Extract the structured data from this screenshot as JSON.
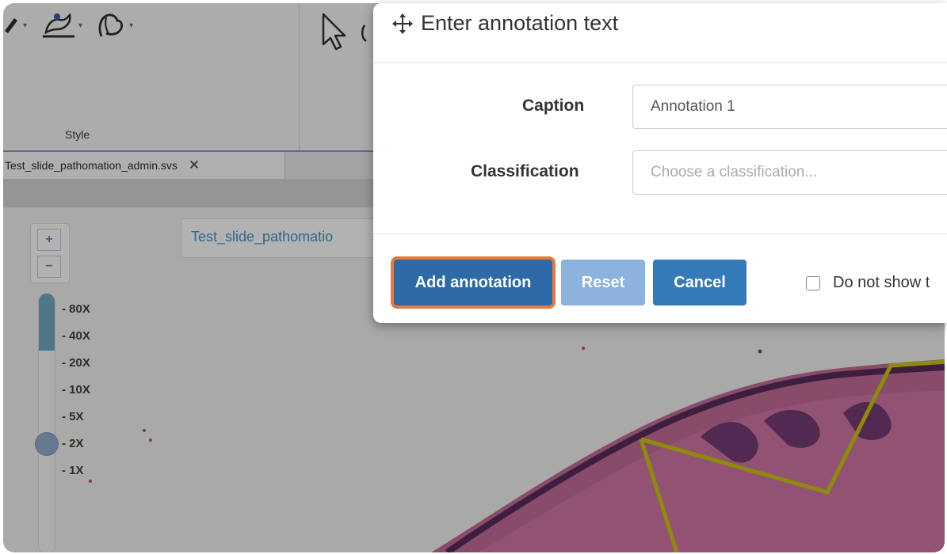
{
  "ribbon": {
    "group_label": "Style",
    "icons": [
      "pen-icon",
      "brush-icon",
      "lasso-icon",
      "pointer-icon"
    ]
  },
  "tabs": [
    {
      "label": "Test_slide_pathomation_admin.svs",
      "close": "✕"
    }
  ],
  "viewer": {
    "slide_name": "Test_slide_pathomatio",
    "zoom_in": "+",
    "zoom_out": "−",
    "zoom_levels": [
      "- 80X",
      "- 40X",
      "- 20X",
      "- 10X",
      "- 5X",
      "- 2X",
      "- 1X"
    ],
    "current_zoom": "2X"
  },
  "dialog": {
    "title": "Enter annotation text",
    "caption_label": "Caption",
    "caption_value": "Annotation 1",
    "classification_label": "Classification",
    "classification_placeholder": "Choose a classification...",
    "add_button": "Add annotation",
    "reset_button": "Reset",
    "cancel_button": "Cancel",
    "dont_show_label": "Do not show t"
  },
  "colors": {
    "primary": "#2d6aa7",
    "highlight_ring": "#e8793a",
    "annotation_outline": "#c9c400",
    "tissue": "#c65a8f"
  }
}
